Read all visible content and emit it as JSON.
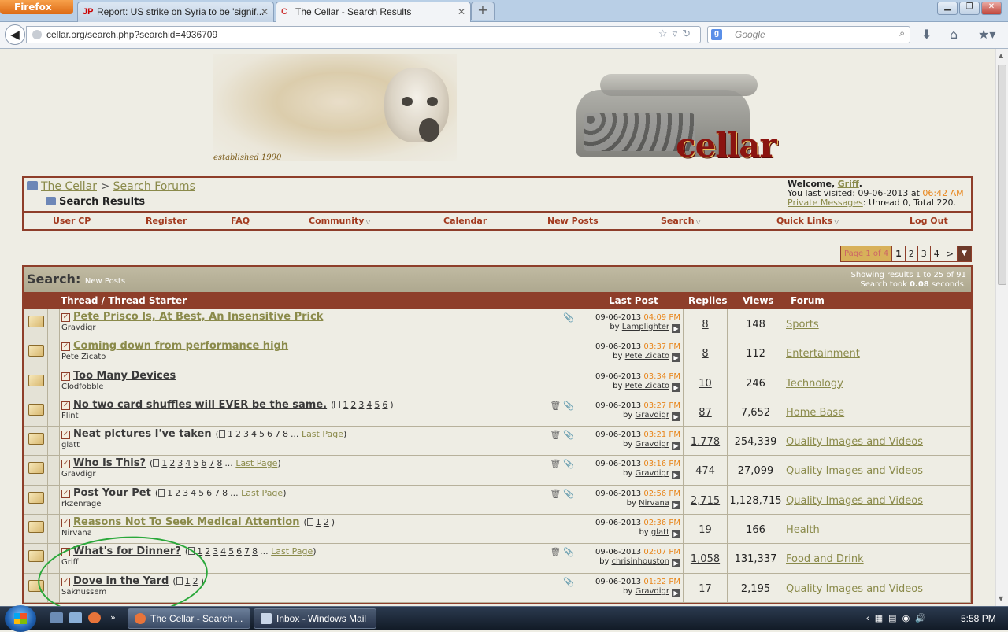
{
  "browser": {
    "menu_label": "Firefox",
    "tabs": [
      {
        "label": "Report: US strike on Syria to be 'signif...",
        "favicon": "JP"
      },
      {
        "label": "The Cellar - Search Results",
        "favicon": "C"
      }
    ],
    "new_tab_label": "+",
    "url": "cellar.org/search.php?searchid=4936709",
    "search_engine": "Google",
    "search_placeholder": "Google"
  },
  "banner": {
    "established": "established 1990",
    "logo_text": "cellar"
  },
  "breadcrumb": {
    "root": "The Cellar",
    "separator": ">",
    "section": "Search Forums",
    "current": "Search Results"
  },
  "welcome": {
    "greeting": "Welcome,",
    "user": "Griff",
    "visited_prefix": "You last visited: 09-06-2013 at",
    "visited_time": "06:42 AM",
    "pm_link": "Private Messages",
    "pm_info": ": Unread 0, Total 220."
  },
  "nav": [
    {
      "label": "User CP",
      "dropdown": false
    },
    {
      "label": "Register",
      "dropdown": false
    },
    {
      "label": "FAQ",
      "dropdown": false
    },
    {
      "label": "Community",
      "dropdown": true
    },
    {
      "label": "Calendar",
      "dropdown": false
    },
    {
      "label": "New Posts",
      "dropdown": false
    },
    {
      "label": "Search",
      "dropdown": true
    },
    {
      "label": "Quick Links",
      "dropdown": true
    },
    {
      "label": "Log Out",
      "dropdown": false
    }
  ],
  "pager": {
    "label": "Page 1 of 4",
    "pages": [
      "1",
      "2",
      "3",
      "4"
    ],
    "current": "1",
    "next": ">"
  },
  "search": {
    "title": "Search:",
    "subtitle": "New Posts",
    "showing": "Showing results 1 to 25 of 91",
    "took_prefix": "Search took",
    "took_value": "0.08",
    "took_suffix": "seconds."
  },
  "columns": {
    "thread": "Thread / Thread Starter",
    "last_post": "Last Post",
    "replies": "Replies",
    "views": "Views",
    "forum": "Forum"
  },
  "threads": [
    {
      "title": "Pete Prisco Is, At Best, An Insensitive Prick",
      "visited": true,
      "starter": "Gravdigr",
      "pages": [],
      "last_page": "",
      "icons": "📎",
      "date": "09-06-2013",
      "time": "04:09 PM",
      "by": "Lamplighter",
      "replies": "8",
      "views": "148",
      "forum": "Sports"
    },
    {
      "title": "Coming down from performance high",
      "visited": true,
      "starter": "Pete Zicato",
      "pages": [],
      "last_page": "",
      "icons": "",
      "date": "09-06-2013",
      "time": "03:37 PM",
      "by": "Pete Zicato",
      "replies": "8",
      "views": "112",
      "forum": "Entertainment"
    },
    {
      "title": "Too Many Devices",
      "visited": false,
      "starter": "Clodfobble",
      "pages": [],
      "last_page": "",
      "icons": "",
      "date": "09-06-2013",
      "time": "03:34 PM",
      "by": "Pete Zicato",
      "replies": "10",
      "views": "246",
      "forum": "Technology"
    },
    {
      "title": "No two card shuffles will EVER be the same.",
      "visited": false,
      "starter": "Flint",
      "pages": [
        "1",
        "2",
        "3",
        "4",
        "5",
        "6"
      ],
      "last_page": "",
      "icons": "🗑📎",
      "date": "09-06-2013",
      "time": "03:27 PM",
      "by": "Gravdigr",
      "replies": "87",
      "views": "7,652",
      "forum": "Home Base"
    },
    {
      "title": "Neat pictures I've taken",
      "visited": false,
      "starter": "glatt",
      "pages": [
        "1",
        "2",
        "3",
        "4",
        "5",
        "6",
        "7",
        "8"
      ],
      "last_page": "Last Page",
      "icons": "🗑📎",
      "date": "09-06-2013",
      "time": "03:21 PM",
      "by": "Gravdigr",
      "replies": "1,778",
      "views": "254,339",
      "forum": "Quality Images and Videos"
    },
    {
      "title": "Who Is This?",
      "visited": false,
      "starter": "Gravdigr",
      "pages": [
        "1",
        "2",
        "3",
        "4",
        "5",
        "6",
        "7",
        "8"
      ],
      "last_page": "Last Page",
      "icons": "🗑📎",
      "date": "09-06-2013",
      "time": "03:16 PM",
      "by": "Gravdigr",
      "replies": "474",
      "views": "27,099",
      "forum": "Quality Images and Videos"
    },
    {
      "title": "Post Your Pet",
      "visited": false,
      "starter": "rkzenrage",
      "pages": [
        "1",
        "2",
        "3",
        "4",
        "5",
        "6",
        "7",
        "8"
      ],
      "last_page": "Last Page",
      "icons": "🗑📎",
      "date": "09-06-2013",
      "time": "02:56 PM",
      "by": "Nirvana",
      "replies": "2,715",
      "views": "1,128,715",
      "forum": "Quality Images and Videos"
    },
    {
      "title": "Reasons Not To Seek Medical Attention",
      "visited": true,
      "starter": "Nirvana",
      "pages": [
        "1",
        "2"
      ],
      "last_page": "",
      "icons": "",
      "date": "09-06-2013",
      "time": "02:36 PM",
      "by": "glatt",
      "replies": "19",
      "views": "166",
      "forum": "Health"
    },
    {
      "title": "What's for Dinner?",
      "visited": false,
      "starter": "Griff",
      "pages": [
        "1",
        "2",
        "3",
        "4",
        "5",
        "6",
        "7",
        "8"
      ],
      "last_page": "Last Page",
      "icons": "🗑📎",
      "date": "09-06-2013",
      "time": "02:07 PM",
      "by": "chrisinhouston",
      "replies": "1,058",
      "views": "131,337",
      "forum": "Food and Drink"
    },
    {
      "title": "Dove in the Yard",
      "visited": false,
      "starter": "Saknussem",
      "pages": [
        "1",
        "2"
      ],
      "last_page": "",
      "icons": "📎",
      "date": "09-06-2013",
      "time": "01:22 PM",
      "by": "Gravdigr",
      "replies": "17",
      "views": "2,195",
      "forum": "Quality Images and Videos"
    }
  ],
  "taskbar": {
    "buttons": [
      "The Cellar - Search ...",
      "Inbox - Windows Mail"
    ],
    "clock": "5:58 PM"
  },
  "colors": {
    "accent": "#8e3e2a",
    "orange": "#e8851a",
    "link": "#8a8a4a",
    "annotation": "#2aa83a"
  }
}
